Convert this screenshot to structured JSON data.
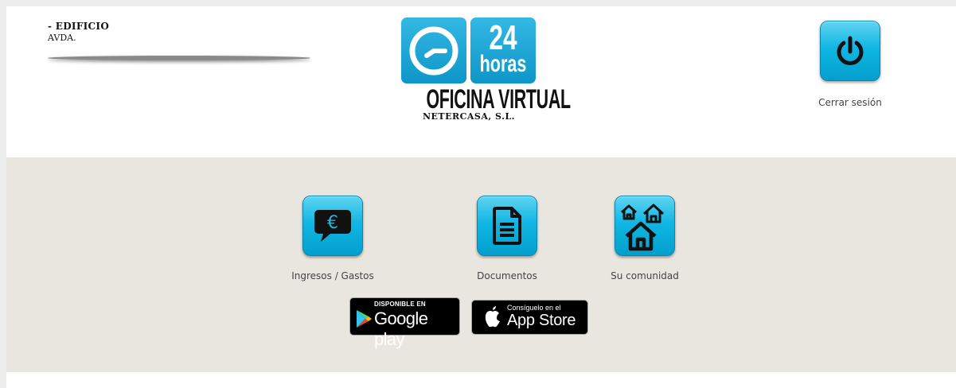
{
  "header": {
    "address_line1": "- EDIFICIO",
    "address_line2": "AVDA.",
    "logo": {
      "hours_number": "24",
      "hours_word": "horas",
      "title": "OFICINA VIRTUAL",
      "company": "NETERCASA, S.L."
    },
    "logout": {
      "icon": "power-icon",
      "label": "Cerrar sesión"
    }
  },
  "menu": {
    "items": [
      {
        "icon": "euro-speech-bubble-icon",
        "label": "Ingresos / Gastos"
      },
      {
        "icon": "document-icon",
        "label": "Documentos"
      },
      {
        "icon": "houses-icon",
        "label": "Su comunidad"
      }
    ]
  },
  "stores": {
    "google_play": {
      "small": "DISPONIBLE EN",
      "big": "Google play"
    },
    "app_store": {
      "small": "Consíguelo en el",
      "big": "App Store"
    }
  },
  "colors": {
    "accent": "#10b6e3",
    "band_background": "#e9e6e0",
    "page_background": "#ffffff"
  }
}
